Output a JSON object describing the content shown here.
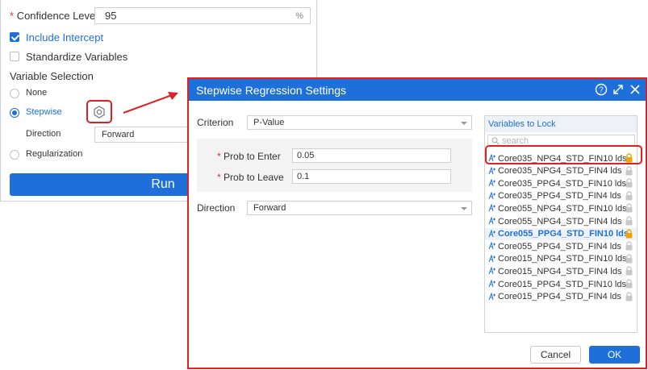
{
  "background": {
    "confidence_label": "Confidence Level",
    "confidence_required": "*",
    "confidence_value": "95",
    "confidence_unit": "%",
    "include_intercept_label": "Include Intercept",
    "standardize_label": "Standardize Variables",
    "variable_selection_label": "Variable Selection",
    "option_none": "None",
    "option_stepwise": "Stepwise",
    "direction_label": "Direction",
    "direction_value": "Forward",
    "option_regularization": "Regularization",
    "run_label": "Run"
  },
  "dialog": {
    "title": "Stepwise Regression Settings",
    "criterion_label": "Criterion",
    "criterion_value": "P-Value",
    "prob_enter_label": "Prob to Enter",
    "prob_enter_value": "0.05",
    "prob_leave_label": "Prob to Leave",
    "prob_leave_value": "0.1",
    "required_mark": "*",
    "direction_label": "Direction",
    "direction_value": "Forward",
    "vars_title": "Variables to Lock",
    "search_placeholder": "search",
    "variables": [
      {
        "label": "Core035_NPG4_STD_FIN10 lds",
        "locked": true,
        "selected": false
      },
      {
        "label": "Core035_NPG4_STD_FIN4 lds",
        "locked": false,
        "selected": false
      },
      {
        "label": "Core035_PPG4_STD_FIN10 lds",
        "locked": false,
        "selected": false
      },
      {
        "label": "Core035_PPG4_STD_FIN4 lds",
        "locked": false,
        "selected": false
      },
      {
        "label": "Core055_NPG4_STD_FIN10 lds",
        "locked": false,
        "selected": false
      },
      {
        "label": "Core055_NPG4_STD_FIN4 lds",
        "locked": false,
        "selected": false
      },
      {
        "label": "Core055_PPG4_STD_FIN10 lds",
        "locked": true,
        "selected": true
      },
      {
        "label": "Core055_PPG4_STD_FIN4 lds",
        "locked": false,
        "selected": false
      },
      {
        "label": "Core015_NPG4_STD_FIN10 lds",
        "locked": false,
        "selected": false
      },
      {
        "label": "Core015_NPG4_STD_FIN4 lds",
        "locked": false,
        "selected": false
      },
      {
        "label": "Core015_PPG4_STD_FIN10 lds",
        "locked": false,
        "selected": false
      },
      {
        "label": "Core015_PPG4_STD_FIN4 lds",
        "locked": false,
        "selected": false
      }
    ],
    "cancel_label": "Cancel",
    "ok_label": "OK"
  },
  "colors": {
    "accent": "#1e6fd9",
    "highlight": "#e02020",
    "lock_active": "#f0a500",
    "lock_inactive": "#c8c8c8"
  },
  "icons": {
    "gear": "gear-icon",
    "help": "help-icon",
    "expand": "expand-icon",
    "close": "close-icon",
    "variable": "variable-icon",
    "lock": "lock-icon",
    "search": "search-icon"
  }
}
